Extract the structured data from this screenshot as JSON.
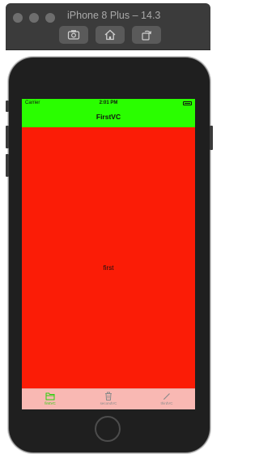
{
  "window": {
    "title": "iPhone 8 Plus – 14.3",
    "toolbar": {
      "screenshot_icon": "camera-icon",
      "home_icon": "home-icon",
      "rotate_icon": "rotate-icon"
    }
  },
  "status_bar": {
    "carrier": "Carrier",
    "time": "2:01 PM"
  },
  "navigation": {
    "title": "FirstVC",
    "bar_color": "#2afe00"
  },
  "content": {
    "label": "first",
    "background_color": "#fb1c06"
  },
  "tab_bar": {
    "background_color": "#f9b8b3",
    "items": [
      {
        "label": "firstVC",
        "icon": "folder-icon",
        "selected": true,
        "color": "#2bd00c"
      },
      {
        "label": "secondVC",
        "icon": "trash-icon",
        "selected": false,
        "color": "#8b8b8b"
      },
      {
        "label": "thirdVC",
        "icon": "pencil-icon",
        "selected": false,
        "color": "#8b8b8b"
      }
    ]
  }
}
